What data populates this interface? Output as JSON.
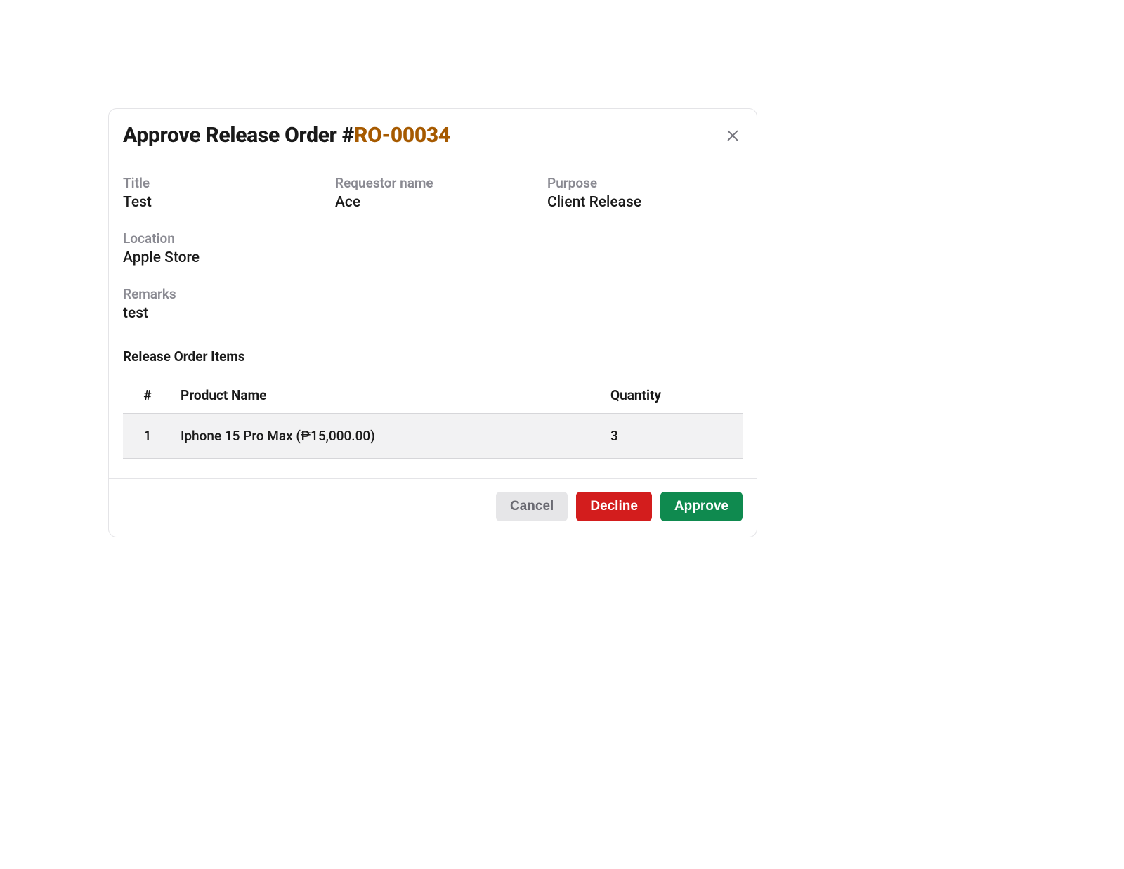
{
  "modal": {
    "title_prefix": "Approve Release Order #",
    "order_number": "RO-00034"
  },
  "fields": {
    "title": {
      "label": "Title",
      "value": "Test"
    },
    "requestor": {
      "label": "Requestor name",
      "value": "Ace"
    },
    "purpose": {
      "label": "Purpose",
      "value": "Client Release"
    },
    "location": {
      "label": "Location",
      "value": "Apple Store"
    },
    "remarks": {
      "label": "Remarks",
      "value": "test"
    }
  },
  "items_section": {
    "title": "Release Order Items",
    "columns": {
      "index": "#",
      "product": "Product Name",
      "quantity": "Quantity"
    },
    "rows": [
      {
        "index": "1",
        "product": "Iphone 15 Pro Max (₱15,000.00)",
        "quantity": "3"
      }
    ]
  },
  "footer": {
    "cancel": "Cancel",
    "decline": "Decline",
    "approve": "Approve"
  }
}
